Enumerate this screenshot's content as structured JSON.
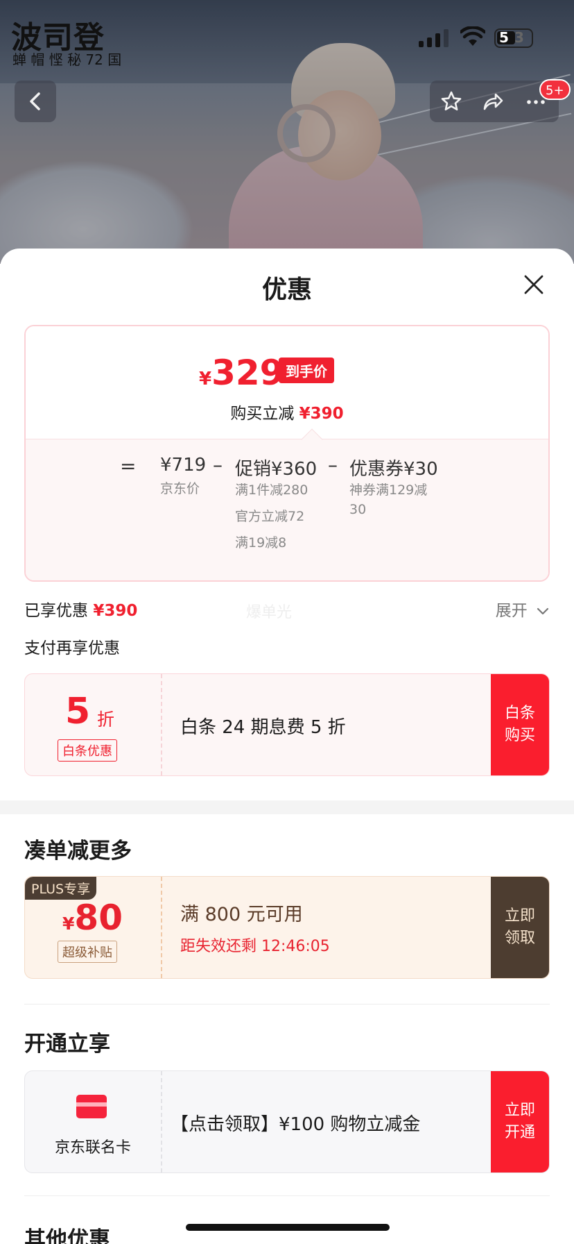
{
  "status_bar": {
    "app_logo": "波司登",
    "app_sub": "蝉 帽 悭 秘 72 国",
    "battery": "5",
    "battery_tail": "3"
  },
  "nav": {
    "more_badge": "5+"
  },
  "sheet": {
    "title": "优惠",
    "price": {
      "yen": "¥",
      "final": "329",
      "final_tag": "到手价",
      "discount_prefix": "购买立减",
      "discount_amount": "¥390"
    },
    "breakdown": {
      "equals": "=",
      "minus": "–",
      "jd_price": "¥719",
      "jd_price_label": "京东价",
      "promo": "促销¥360",
      "promo_details": [
        "满1件减280",
        "官方立减72",
        "满19减8"
      ],
      "coupon": "优惠券¥30",
      "coupon_detail_1": "神券满129减",
      "coupon_detail_2": "30"
    },
    "enjoyed_prefix": "已享优惠",
    "enjoyed_amount": "¥390",
    "watermark": "爆单光",
    "expand_label": "展开",
    "pay_section_title": "支付再享优惠",
    "baitiao": {
      "big": "5",
      "unit": "折",
      "tag": "白条优惠",
      "desc": "白条 24 期息费 5 折",
      "action_l1": "白条",
      "action_l2": "购买"
    },
    "more_section_title": "凑单减更多",
    "plus_coupon": {
      "badge": "PLUS专享",
      "yen": "¥",
      "amount": "80",
      "tag": "超级补贴",
      "condition": "满 800 元可用",
      "countdown": "距失效还剩 12:46:05",
      "action_l1": "立即",
      "action_l2": "领取"
    },
    "open_section_title": "开通立享",
    "card_offer": {
      "card_name": "京东联名卡",
      "desc": "【点击领取】¥100 购物立减金",
      "action_l1": "立即",
      "action_l2": "开通"
    },
    "other_section_title": "其他优惠"
  },
  "colors": {
    "accent_red": "#f0202f",
    "plus_brown": "#4d3d30"
  }
}
